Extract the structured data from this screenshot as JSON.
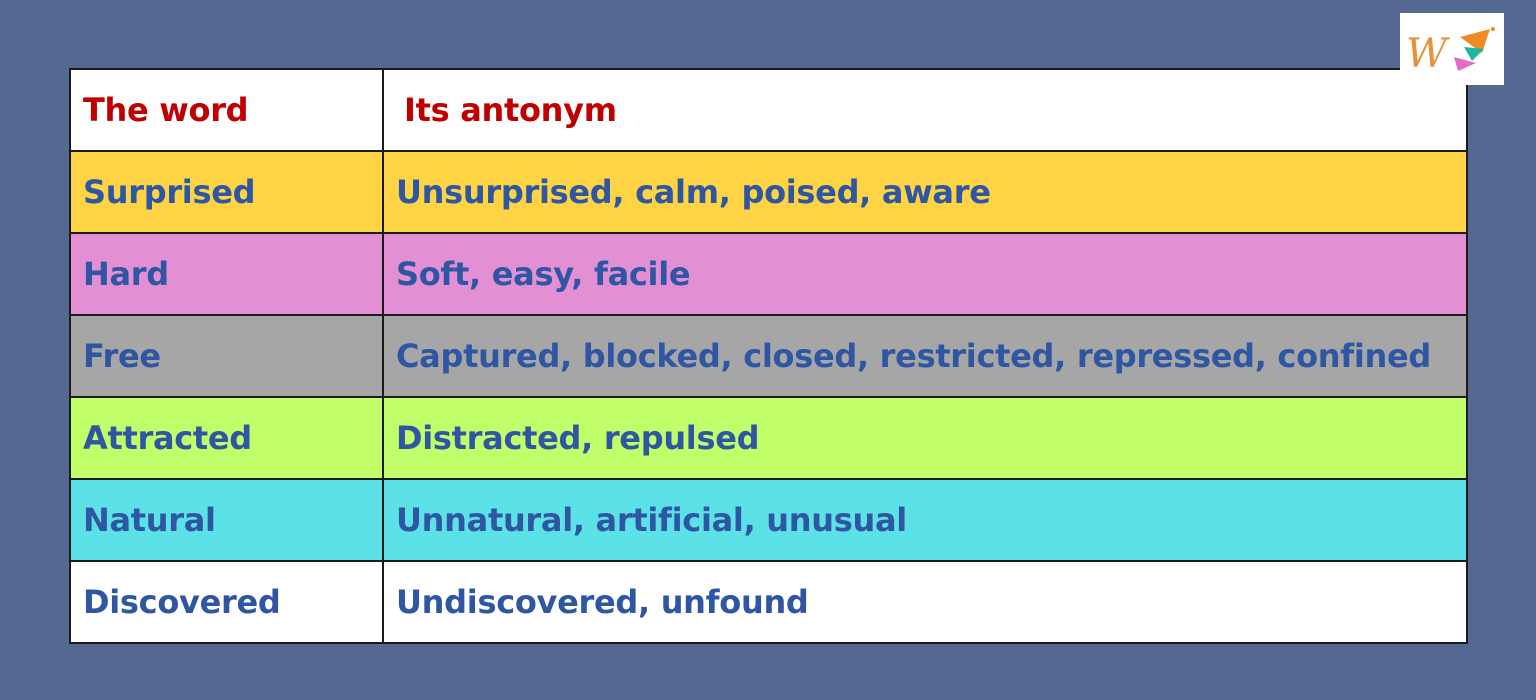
{
  "table": {
    "header": {
      "word": "The word",
      "antonym": "Its antonym"
    },
    "rows": [
      {
        "word": "Surprised",
        "antonyms": "Unsurprised, calm, poised, aware",
        "bg": "#fed444"
      },
      {
        "word": "Hard",
        "antonyms": "Soft, easy, facile",
        "bg": "#e28fd4"
      },
      {
        "word": "Free",
        "antonyms": "Captured, blocked, closed, restricted, repressed, confined",
        "bg": "#a6a6a6"
      },
      {
        "word": "Attracted",
        "antonyms": "Distracted, repulsed",
        "bg": "#c1ff6a"
      },
      {
        "word": "Natural",
        "antonyms": "Unnatural, artificial, unusual",
        "bg": "#5ce1e6"
      },
      {
        "word": "Discovered",
        "antonyms": "Undiscovered, unfound",
        "bg": "#ffffff"
      }
    ],
    "header_text_color": "#c00000",
    "body_text_color": "#2f56a3"
  },
  "page": {
    "background": "#556891"
  },
  "logo": {
    "letter": "W",
    "icon": "logo-icon"
  }
}
